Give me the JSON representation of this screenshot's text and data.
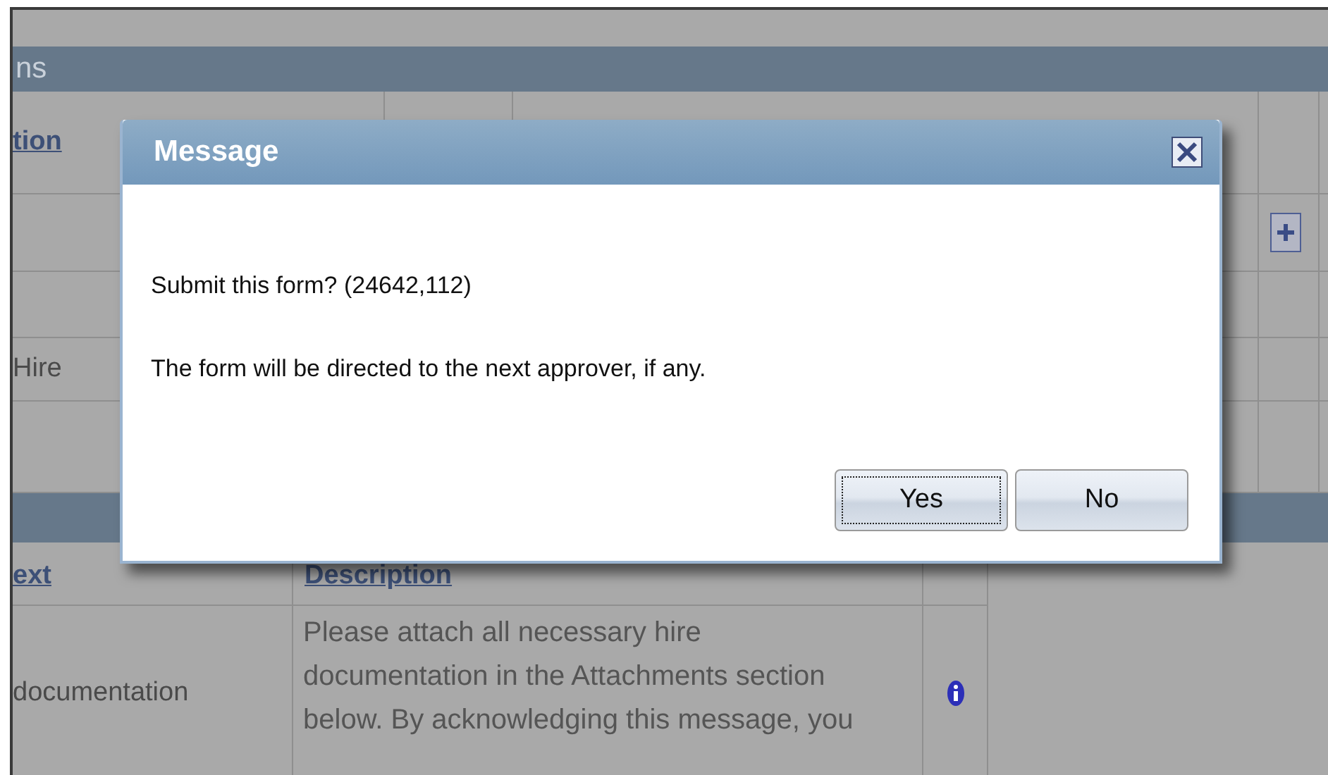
{
  "upper_section": {
    "title": "ns",
    "column_header": "tion",
    "rows": [
      {
        "kind": "add"
      },
      {
        "kind": "blank"
      },
      {
        "kind": "text",
        "text": "Hire"
      },
      {
        "kind": "blank"
      }
    ]
  },
  "lower_section": {
    "columns": [
      "ext",
      "Description"
    ],
    "row": {
      "name": "documentation",
      "description": "Please attach all necessary hire documentation in the Attachments section below. By acknowledging this message, you"
    }
  },
  "dialog": {
    "title": "Message",
    "lines": [
      "Submit this form? (24642,112)",
      "The form will be directed to the next approver, if any."
    ],
    "buttons": [
      {
        "label": "Yes",
        "focused": true
      },
      {
        "label": "No",
        "focused": false
      }
    ]
  }
}
